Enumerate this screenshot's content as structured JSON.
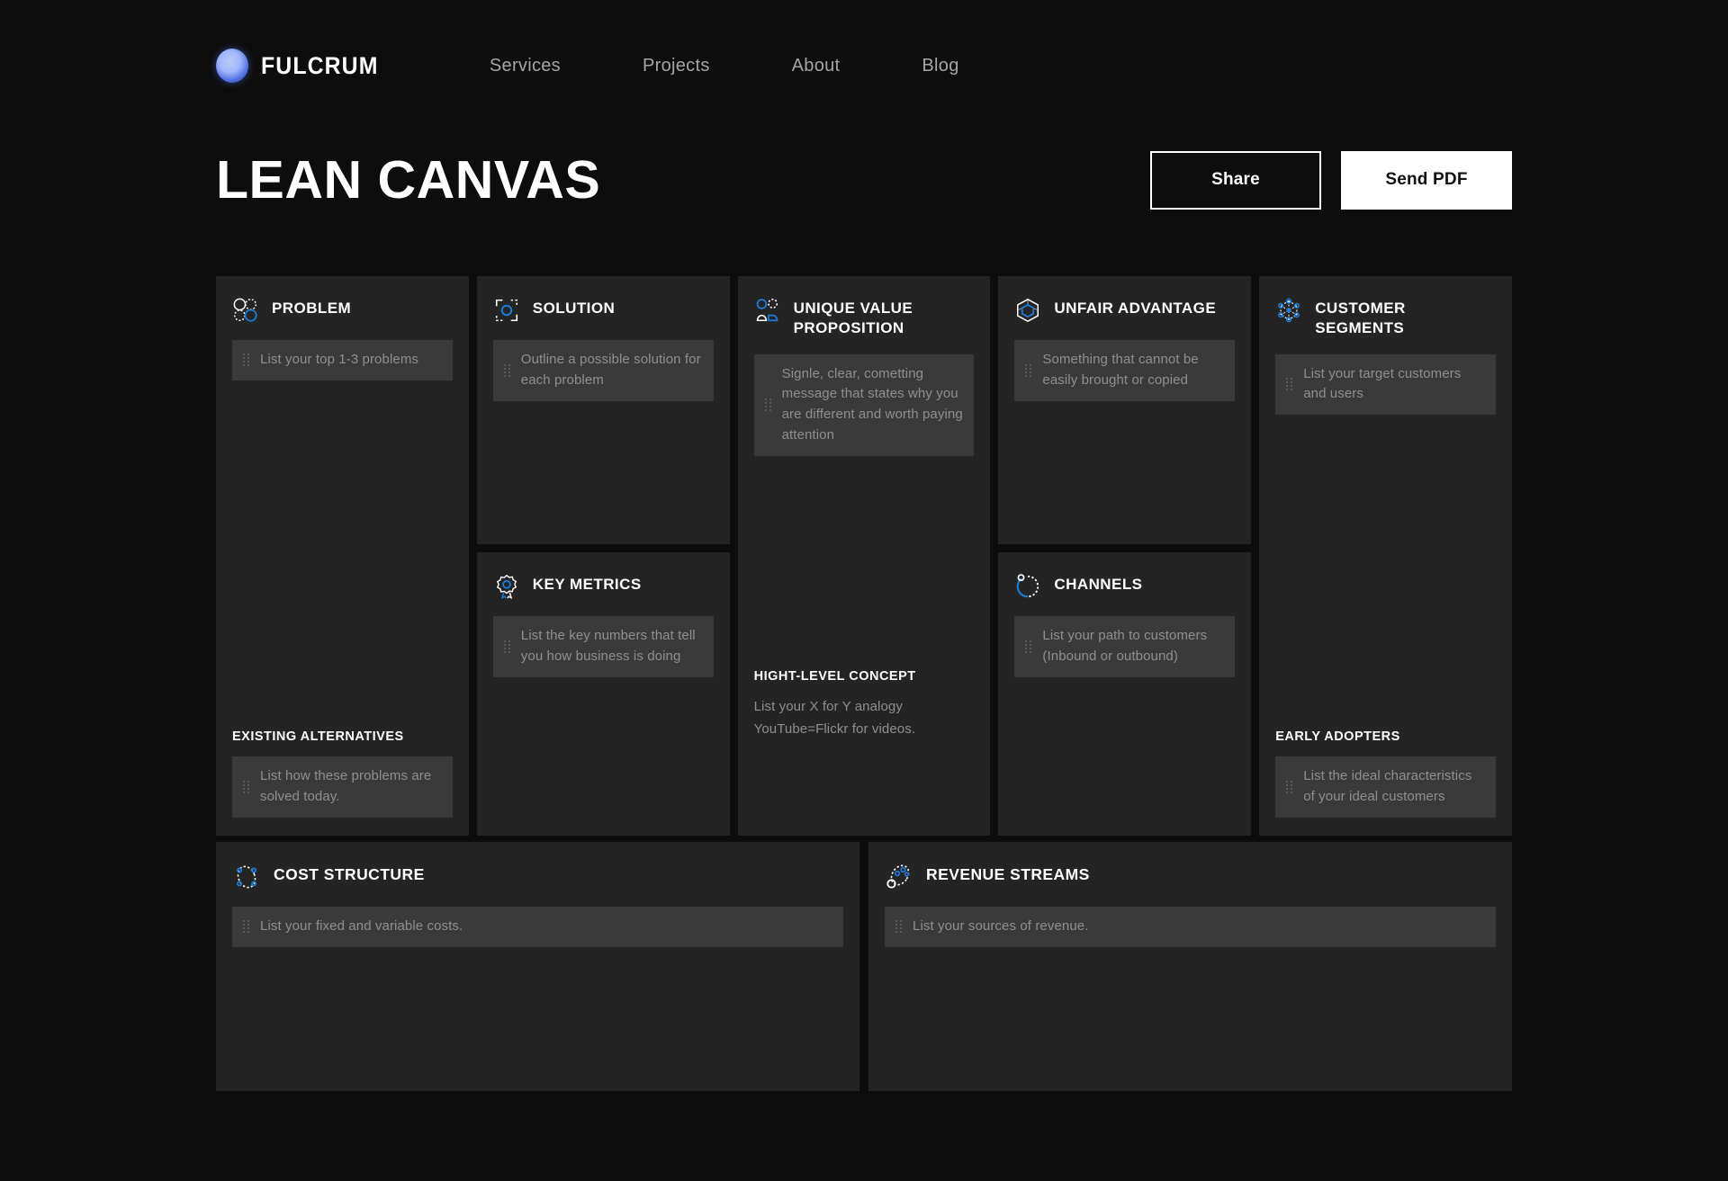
{
  "brand": {
    "name": "FULCRUM",
    "logo_icon": "sphere-logo-icon",
    "accent": "#1a7fe0"
  },
  "nav": {
    "items": [
      {
        "label": "Services"
      },
      {
        "label": "Projects"
      },
      {
        "label": "About"
      },
      {
        "label": "Blog"
      }
    ]
  },
  "header": {
    "title": "LEAN CANVAS",
    "share_label": "Share",
    "send_pdf_label": "Send PDF"
  },
  "canvas": {
    "problem": {
      "title": "PROBLEM",
      "icon": "overlapping-circles-icon",
      "placeholder": "List your top 1-3 problems",
      "sub_title": "EXISTING ALTERNATIVES",
      "sub_placeholder": "List how these problems are solved today."
    },
    "solution": {
      "title": "SOLUTION",
      "icon": "focus-target-icon",
      "placeholder": "Outline a possible solution for each problem"
    },
    "key_metrics": {
      "title": "KEY METRICS",
      "icon": "award-badge-icon",
      "placeholder": "List the key numbers that tell you how business is doing"
    },
    "unique_value_proposition": {
      "title": "UNIQUE VALUE PROPOSITION",
      "icon": "persons-shapes-icon",
      "placeholder": "Signle, clear, cometting message that states why you are different and worth paying attention",
      "sub_title": "HIGHT-LEVEL CONCEPT",
      "sub_text_line1": "List your X for Y analogy",
      "sub_text_line2": "YouTube=Flickr for videos."
    },
    "unfair_advantage": {
      "title": "UNFAIR ADVANTAGE",
      "icon": "cube-icon",
      "placeholder": "Something that cannot be easily brought or copied"
    },
    "channels": {
      "title": "CHANNELS",
      "icon": "circular-arrow-icon",
      "placeholder": "List your path to customers (Inbound or outbound)"
    },
    "customer_segments": {
      "title": "CUSTOMER SEGMENTS",
      "icon": "network-nodes-icon",
      "placeholder": "List your target customers and users",
      "sub_title": "EARLY ADOPTERS",
      "sub_placeholder": "List the ideal characteristics of your ideal customers"
    },
    "cost_structure": {
      "title": "COST STRUCTURE",
      "icon": "dotted-ellipse-nodes-icon",
      "placeholder": "List your fixed and variable costs."
    },
    "revenue_streams": {
      "title": "REVENUE STREAMS",
      "icon": "orbit-bubbles-icon",
      "placeholder": "List your sources of revenue."
    }
  }
}
